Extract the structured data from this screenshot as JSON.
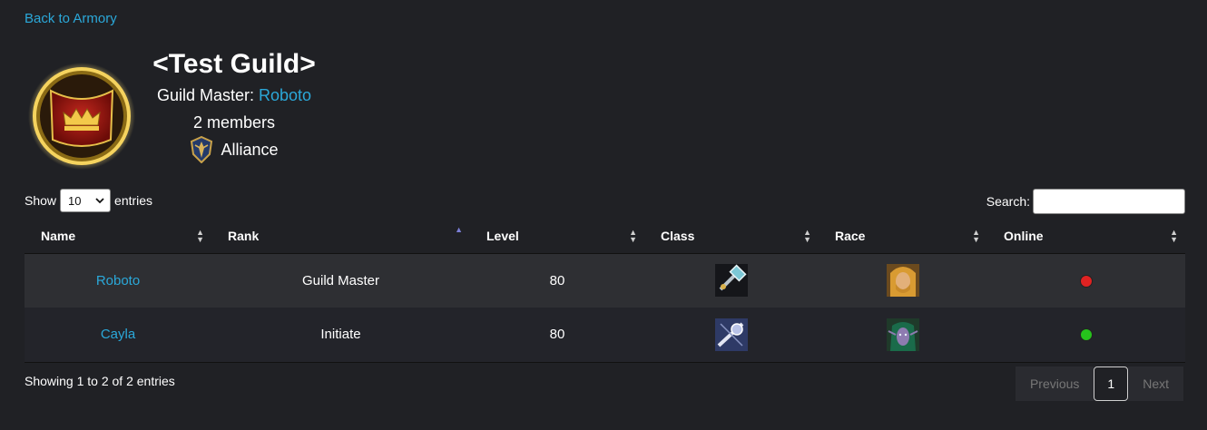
{
  "nav": {
    "back_label": "Back to Armory"
  },
  "guild": {
    "name": "<Test Guild>",
    "master_prefix": "Guild Master: ",
    "master_name": "Roboto",
    "members": "2 members",
    "faction": "Alliance",
    "emblem_icon": "crown-banner-icon",
    "faction_icon": "alliance-crest-icon"
  },
  "table_controls": {
    "show_label": "Show",
    "page_length": "10",
    "entries_label": "entries",
    "search_label": "Search:",
    "search_value": ""
  },
  "table": {
    "columns": [
      "Name",
      "Rank",
      "Level",
      "Class",
      "Race",
      "Online"
    ],
    "sorted_column": "Rank",
    "rows": [
      {
        "name": "Roboto",
        "rank": "Guild Master",
        "level": "80",
        "class_icon": "paladin-hammer-icon",
        "race_icon": "human-male-icon",
        "online": false,
        "status_color": "#e02222"
      },
      {
        "name": "Cayla",
        "rank": "Initiate",
        "level": "80",
        "class_icon": "priest-staff-icon",
        "race_icon": "night-elf-female-icon",
        "online": true,
        "status_color": "#26c21c"
      }
    ]
  },
  "footer": {
    "info": "Showing 1 to 2 of 2 entries",
    "prev_label": "Previous",
    "current_page": "1",
    "next_label": "Next"
  },
  "colors": {
    "background": "#202125",
    "link": "#2ba8d9",
    "row_odd": "#2e2f33",
    "row_even": "#23242a"
  }
}
